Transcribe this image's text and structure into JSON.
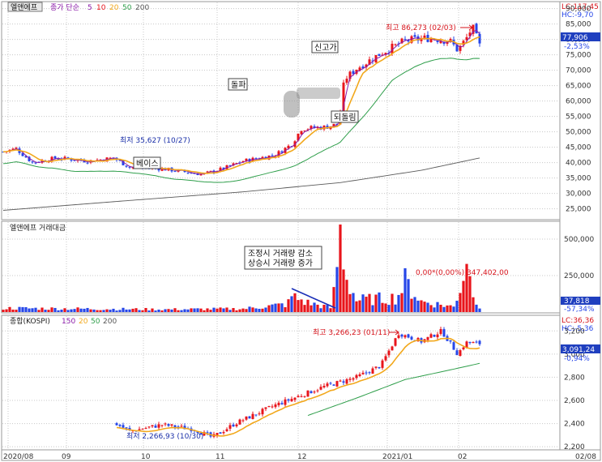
{
  "colors": {
    "up": "#e8141b",
    "down": "#2646e8",
    "ma5": "#8a1aa8",
    "ma20": "#f2a81c",
    "ma50": "#2e9e4a",
    "ma200": "#5a5a5a",
    "current_box": "#1f3fbf",
    "annotation_red": "#d6121a",
    "grid": "#c8c8c8"
  },
  "top_panel": {
    "title": "엘앤에프",
    "ma_label": "종가 단순",
    "ma_periods": [
      "5",
      "10",
      "20",
      "50",
      "200"
    ],
    "lc": "LC:117,45",
    "hc": "HC:-9,70",
    "current_price": "77,906",
    "current_change": "-2,53%",
    "high_annotation": "최고 86,273 (02/03)",
    "low_annotation": "최저 35,627 (10/27)",
    "notes": [
      "신고가",
      "돌파",
      "되돌림",
      "베이스"
    ],
    "y_ticks": [
      "90,000",
      "85,000",
      "80,000",
      "75,000",
      "70,000",
      "65,000",
      "60,000",
      "55,000",
      "50,000",
      "45,000",
      "40,000",
      "35,000",
      "30,000",
      "25,000"
    ]
  },
  "volume_panel": {
    "title": "엘앤에프 거래대금",
    "note_line1": "조정시 거래량 감소",
    "note_line2": "상승시 거래량 증가",
    "peak_annotation": "0,00*(0,00%) 347,402,00",
    "current_value": "37,818",
    "current_change": "-57,34%",
    "y_ticks": [
      "500,000",
      "250,000"
    ]
  },
  "kospi_panel": {
    "title": "종합(KOSPI)",
    "ma_periods": [
      "150",
      "20",
      "50",
      "200"
    ],
    "lc": "LC:36,36",
    "hc": "HC:-5,36",
    "current_value": "3,091,24",
    "current_change": "-0,94%",
    "high_annotation": "최고 3,266,23 (01/11)",
    "low_annotation": "최저 2,266,93 (10/30)",
    "y_ticks": [
      "3,200",
      "3,000",
      "2,800",
      "2,600",
      "2,400",
      "2,200"
    ]
  },
  "x_axis_labels": [
    "2020/08",
    "09",
    "10",
    "11",
    "12",
    "2021/01",
    "02",
    "02/08"
  ],
  "chart_data": [
    {
      "type": "candlestick",
      "title": "엘앤에프",
      "x": [
        "2020/08",
        "09",
        "10",
        "11",
        "12",
        "2021/01",
        "02"
      ],
      "series": [
        {
          "name": "5",
          "values": [
            44500,
            41000,
            38500,
            37500,
            45500,
            69000,
            80000
          ]
        },
        {
          "name": "20",
          "values": [
            42500,
            40000,
            38000,
            36800,
            44000,
            68000,
            79000
          ]
        },
        {
          "name": "50",
          "values": [
            38500,
            39300,
            38800,
            37000,
            42000,
            58000,
            66000
          ]
        },
        {
          "name": "200",
          "values": [
            22000,
            25500,
            29000,
            31500,
            35500,
            38500,
            42000
          ]
        }
      ],
      "ylim": [
        22000,
        92000
      ]
    },
    {
      "type": "bar",
      "title": "엘앤에프 거래대금",
      "x": [
        "2020/08",
        "09",
        "10",
        "11",
        "12",
        "2021/01",
        "02"
      ],
      "series": [
        {
          "name": "거래대금",
          "values": [
            60000,
            55000,
            40000,
            35000,
            200000,
            350000,
            347402
          ]
        }
      ],
      "ylim": [
        0,
        600000
      ]
    },
    {
      "type": "candlestick",
      "title": "종합(KOSPI)",
      "x": [
        "10",
        "11",
        "12",
        "2021/01",
        "02"
      ],
      "series": [
        {
          "name": "close",
          "values": [
            2380,
            2300,
            2560,
            3100,
            3091
          ]
        },
        {
          "name": "20",
          "values": [
            2340,
            2310,
            2520,
            2980,
            3110
          ]
        },
        {
          "name": "50",
          "values": [
            2350,
            2330,
            2440,
            2750,
            2920
          ]
        }
      ],
      "ylim": [
        2200,
        3300
      ]
    }
  ]
}
